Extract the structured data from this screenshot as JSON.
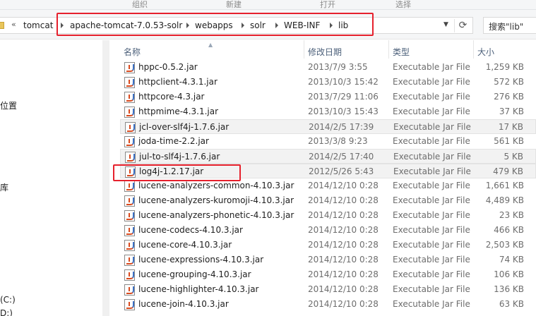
{
  "ribbon": {
    "groups": [
      "组织",
      "新建",
      "打开",
      "选择"
    ]
  },
  "address": {
    "chevron": "«",
    "crumbs": [
      "tomcat",
      "apache-tomcat-7.0.53-solr",
      "webapps",
      "solr",
      "WEB-INF",
      "lib"
    ],
    "refresh_icon": "⟳",
    "dropdown_icon": "▼"
  },
  "search": {
    "text": "搜索\"lib\""
  },
  "nav": {
    "items": [
      "位置",
      "库",
      "(C:)",
      "D:)"
    ]
  },
  "columns": {
    "name": "名称",
    "modified": "修改日期",
    "type": "类型",
    "size": "大小"
  },
  "files": [
    {
      "name": "hppc-0.5.2.jar",
      "date": "2013/7/9 3:55",
      "type": "Executable Jar File",
      "size": "1,259 KB"
    },
    {
      "name": "httpclient-4.3.1.jar",
      "date": "2013/10/3 15:42",
      "type": "Executable Jar File",
      "size": "572 KB"
    },
    {
      "name": "httpcore-4.3.jar",
      "date": "2013/7/29 11:06",
      "type": "Executable Jar File",
      "size": "276 KB"
    },
    {
      "name": "httpmime-4.3.1.jar",
      "date": "2013/10/3 15:43",
      "type": "Executable Jar File",
      "size": "37 KB"
    },
    {
      "name": "jcl-over-slf4j-1.7.6.jar",
      "date": "2014/2/5 17:39",
      "type": "Executable Jar File",
      "size": "17 KB"
    },
    {
      "name": "joda-time-2.2.jar",
      "date": "2013/3/8 9:23",
      "type": "Executable Jar File",
      "size": "561 KB"
    },
    {
      "name": "jul-to-slf4j-1.7.6.jar",
      "date": "2014/2/5 17:40",
      "type": "Executable Jar File",
      "size": "5 KB"
    },
    {
      "name": "log4j-1.2.17.jar",
      "date": "2012/5/26 5:43",
      "type": "Executable Jar File",
      "size": "479 KB"
    },
    {
      "name": "lucene-analyzers-common-4.10.3.jar",
      "date": "2014/12/10 0:28",
      "type": "Executable Jar File",
      "size": "1,661 KB"
    },
    {
      "name": "lucene-analyzers-kuromoji-4.10.3.jar",
      "date": "2014/12/10 0:28",
      "type": "Executable Jar File",
      "size": "4,489 KB"
    },
    {
      "name": "lucene-analyzers-phonetic-4.10.3.jar",
      "date": "2014/12/10 0:28",
      "type": "Executable Jar File",
      "size": "23 KB"
    },
    {
      "name": "lucene-codecs-4.10.3.jar",
      "date": "2014/12/10 0:28",
      "type": "Executable Jar File",
      "size": "466 KB"
    },
    {
      "name": "lucene-core-4.10.3.jar",
      "date": "2014/12/10 0:28",
      "type": "Executable Jar File",
      "size": "2,503 KB"
    },
    {
      "name": "lucene-expressions-4.10.3.jar",
      "date": "2014/12/10 0:28",
      "type": "Executable Jar File",
      "size": "74 KB"
    },
    {
      "name": "lucene-grouping-4.10.3.jar",
      "date": "2014/12/10 0:28",
      "type": "Executable Jar File",
      "size": "106 KB"
    },
    {
      "name": "lucene-highlighter-4.10.3.jar",
      "date": "2014/12/10 0:28",
      "type": "Executable Jar File",
      "size": "136 KB"
    },
    {
      "name": "lucene-join-4.10.3.jar",
      "date": "2014/12/10 0:28",
      "type": "Executable Jar File",
      "size": "63 KB"
    }
  ],
  "colors": {
    "highlight": "#e6212d",
    "header_text": "#4c607a",
    "folder": "#e8c55b"
  }
}
